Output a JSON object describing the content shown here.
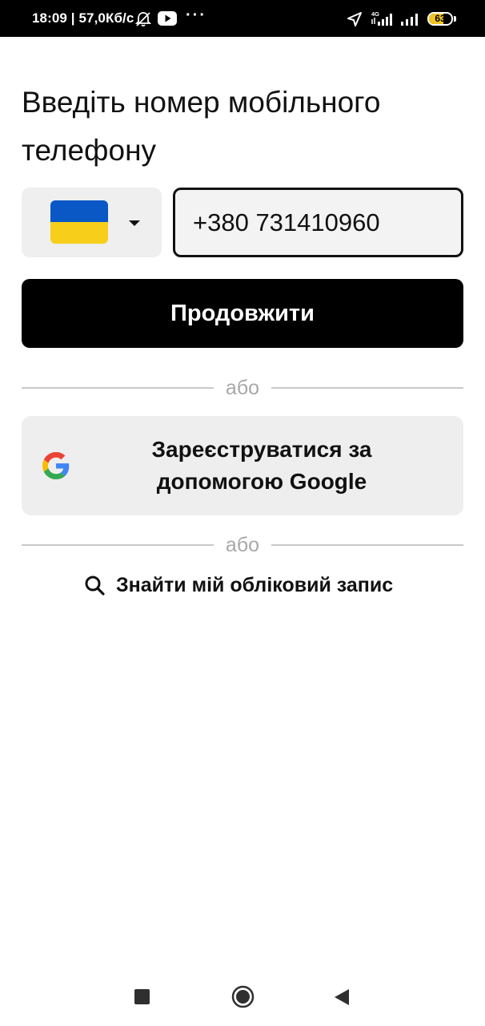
{
  "status_bar": {
    "time_speed": "18:09 | 57,0Кб/с",
    "icons": [
      "muted-bell-icon",
      "youtube-icon",
      "more-dots-icon",
      "location-arrow-icon",
      "signal-4g-icon",
      "signal-icon",
      "battery-icon"
    ],
    "network_label": "4G",
    "battery_percent": "63",
    "battery_level": 0.63,
    "colors": {
      "background": "#000000",
      "text": "#ffffff",
      "battery": "#f3c420"
    }
  },
  "title": "Введіть номер мобільного телефону",
  "country_selector": {
    "flag": "ukraine-flag",
    "flag_colors": [
      "#0a57c6",
      "#f7cf1a"
    ],
    "dropdown_icon": "caret-down-icon"
  },
  "phone_input": {
    "value": "+380 731410960"
  },
  "continue_button": {
    "label": "Продовжити",
    "color": "#000000"
  },
  "divider_text": "або",
  "google_button": {
    "label": "Зареєструватися за допомогою Google",
    "icon": "google-icon",
    "background": "#eeeeee"
  },
  "find_account": {
    "label": "Знайти мій обліковий запис",
    "icon": "search-icon"
  },
  "nav_bar": {
    "buttons": [
      "recents-square-icon",
      "home-circle-icon",
      "back-triangle-icon"
    ]
  }
}
